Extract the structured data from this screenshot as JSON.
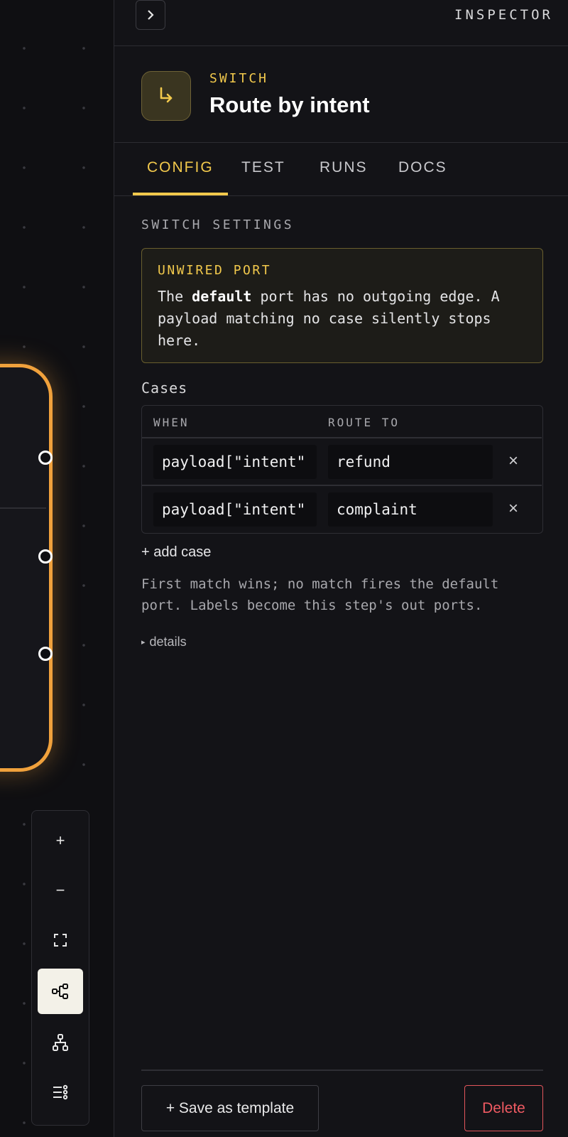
{
  "panel": {
    "title": "INSPECTOR"
  },
  "node": {
    "type": "SWITCH",
    "title": "Route by intent",
    "icon": "branch-arrow-icon",
    "accent": "#f2c94c"
  },
  "tabs": [
    {
      "label": "CONFIG",
      "active": true
    },
    {
      "label": "TEST",
      "active": false
    },
    {
      "label": "RUNS",
      "active": false
    },
    {
      "label": "DOCS",
      "active": false
    }
  ],
  "settings": {
    "section_label": "SWITCH SETTINGS"
  },
  "warning": {
    "title": "UNWIRED PORT",
    "text_prefix": "The ",
    "text_bold": "default",
    "text_suffix": " port has no outgoing edge. A payload matching no case silently stops here."
  },
  "cases": {
    "label": "Cases",
    "columns": [
      "WHEN",
      "ROUTE TO"
    ],
    "rows": [
      {
        "when": "payload[\"intent\"",
        "route_to": "refund"
      },
      {
        "when": "payload[\"intent\"",
        "route_to": "complaint"
      }
    ],
    "remove_glyph": "×"
  },
  "add_case_label": "+ add case",
  "help_text": "First match wins; no match fires the default port. Labels become this step's out ports.",
  "details_label": "details",
  "footer": {
    "save_template_label": "+ Save as template",
    "delete_label": "Delete"
  },
  "toolbar": {
    "zoom_in": "+",
    "zoom_out": "−",
    "icons": [
      "fit-view-icon",
      "horizontal-layout-icon",
      "tree-layout-icon",
      "list-settings-icon"
    ],
    "active": "horizontal-layout-icon"
  },
  "colors": {
    "node_border": "#f0a13c",
    "danger": "#ef5a62",
    "background": "#0f0f12"
  }
}
